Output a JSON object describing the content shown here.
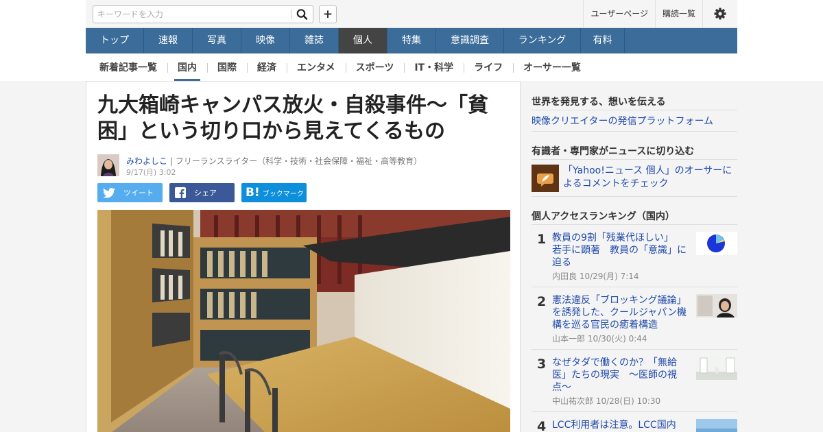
{
  "header": {
    "search_placeholder": "キーワードを入力",
    "plus_label": "+",
    "links": [
      "ユーザーページ",
      "購読一覧"
    ]
  },
  "main_nav": {
    "items": [
      "トップ",
      "速報",
      "写真",
      "映像",
      "雑誌",
      "個人",
      "特集",
      "意識調査",
      "ランキング",
      "有料"
    ],
    "active": "個人"
  },
  "sub_nav": {
    "items": [
      "新着記事一覧",
      "国内",
      "国際",
      "経済",
      "エンタメ",
      "スポーツ",
      "IT・科学",
      "ライフ",
      "オーサー一覧"
    ],
    "active": "国内"
  },
  "article": {
    "title_line1": "九大箱崎キャンパス放火・自殺事件～「貧",
    "title_line2": "困」という切り口から見えてくるもの",
    "author_name": "みわよしこ",
    "author_desc": "| フリーランスライター（科学・技術・社会保障・福祉・高等教育）",
    "date": "9/17(月) 3:02",
    "share": {
      "tweet": "ツイート",
      "facebook": "シェア",
      "bookmark": "ブックマーク"
    }
  },
  "sidebar": {
    "section1_heading": "世界を発見する、想いを伝える",
    "section1_link": "映像クリエイターの発信プラットフォーム",
    "section2_heading": "有識者・専門家がニュースに切り込む",
    "section2_link_line1": "「Yahoo!ニュース 個人」のオーサーに",
    "section2_link_line2": "よるコメントをチェック",
    "ranking_heading": "個人アクセスランキング（国内）",
    "ranking": [
      {
        "rank": "1",
        "lines": [
          "教員の9割「残業代ほしい」",
          "若手に顕著　教員の「意識」に",
          "迫る"
        ],
        "meta": "内田良  10/29(月) 7:14"
      },
      {
        "rank": "2",
        "lines": [
          "憲法違反「ブロッキング議論」",
          "を誘発した、クールジャパン機",
          "構を巡る官民の癒着構造"
        ],
        "meta": "山本一郎  10/30(火) 0:44"
      },
      {
        "rank": "3",
        "lines": [
          "なぜタダで働くのか？「無給",
          "医」たちの現実　〜医師の視",
          "点〜"
        ],
        "meta": "中山祐次郎  10/28(日) 10:30"
      },
      {
        "rank": "4",
        "lines": [
          "LCC利用者は注意。LCC国内"
        ],
        "meta": ""
      }
    ]
  },
  "icons": {
    "search": "search-icon",
    "settings": "gear-icon",
    "twitter": "twitter-icon",
    "facebook": "facebook-icon",
    "hatena": "hatena-bookmark-icon",
    "expert": "quill-icon"
  },
  "colors": {
    "nav_blue": "#3c6c99",
    "nav_active": "#444444",
    "link_blue": "#1f49a8",
    "twitter": "#55acee",
    "facebook": "#3b5998",
    "hatena": "#0d8fdc"
  }
}
